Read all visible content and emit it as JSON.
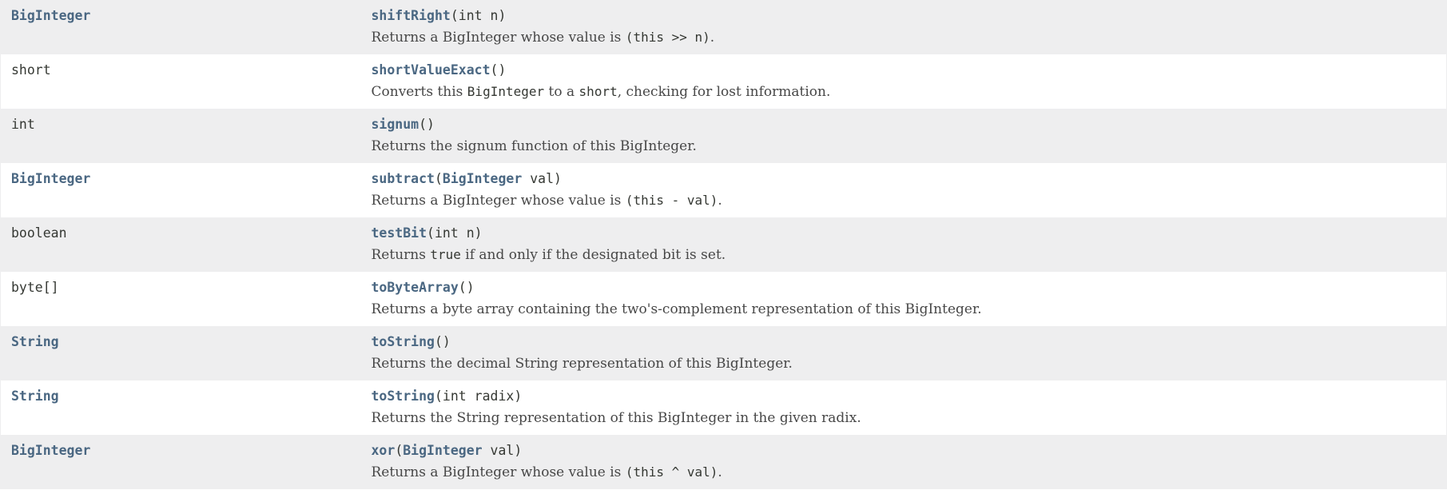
{
  "rows": [
    {
      "type": "BigInteger",
      "type_is_link": true,
      "method": "shiftRight",
      "args_before": "(int n)",
      "param_link": "",
      "args_after": "",
      "desc": [
        [
          "t",
          "Returns a BigInteger whose value is "
        ],
        [
          "c",
          "(this >> n)"
        ],
        [
          "t",
          "."
        ]
      ]
    },
    {
      "type": "short",
      "type_is_link": false,
      "method": "shortValueExact",
      "args_before": "()",
      "param_link": "",
      "args_after": "",
      "desc": [
        [
          "t",
          "Converts this "
        ],
        [
          "c",
          "BigInteger"
        ],
        [
          "t",
          " to a "
        ],
        [
          "c",
          "short"
        ],
        [
          "t",
          ", checking for lost information."
        ]
      ]
    },
    {
      "type": "int",
      "type_is_link": false,
      "method": "signum",
      "args_before": "()",
      "param_link": "",
      "args_after": "",
      "desc": [
        [
          "t",
          "Returns the signum function of this BigInteger."
        ]
      ]
    },
    {
      "type": "BigInteger",
      "type_is_link": true,
      "method": "subtract",
      "args_before": "(",
      "param_link": "BigInteger",
      "args_after": " val)",
      "desc": [
        [
          "t",
          "Returns a BigInteger whose value is "
        ],
        [
          "c",
          "(this - val)"
        ],
        [
          "t",
          "."
        ]
      ]
    },
    {
      "type": "boolean",
      "type_is_link": false,
      "method": "testBit",
      "args_before": "(int n)",
      "param_link": "",
      "args_after": "",
      "desc": [
        [
          "t",
          "Returns "
        ],
        [
          "c",
          "true"
        ],
        [
          "t",
          " if and only if the designated bit is set."
        ]
      ]
    },
    {
      "type": "byte[]",
      "type_is_link": false,
      "method": "toByteArray",
      "args_before": "()",
      "param_link": "",
      "args_after": "",
      "desc": [
        [
          "t",
          "Returns a byte array containing the two's-complement representation of this BigInteger."
        ]
      ]
    },
    {
      "type": "String",
      "type_is_link": true,
      "method": "toString",
      "args_before": "()",
      "param_link": "",
      "args_after": "",
      "desc": [
        [
          "t",
          "Returns the decimal String representation of this BigInteger."
        ]
      ]
    },
    {
      "type": "String",
      "type_is_link": true,
      "method": "toString",
      "args_before": "(int radix)",
      "param_link": "",
      "args_after": "",
      "desc": [
        [
          "t",
          "Returns the String representation of this BigInteger in the given radix."
        ]
      ]
    },
    {
      "type": "BigInteger",
      "type_is_link": true,
      "method": "xor",
      "args_before": "(",
      "param_link": "BigInteger",
      "args_after": " val)",
      "desc": [
        [
          "t",
          "Returns a BigInteger whose value is "
        ],
        [
          "c",
          "(this ^ val)"
        ],
        [
          "t",
          "."
        ]
      ]
    }
  ],
  "colors": {
    "link": "#4a6782",
    "row_alt_bg": "#eeeeef",
    "row_bg": "#ffffff",
    "text": "#353833"
  }
}
